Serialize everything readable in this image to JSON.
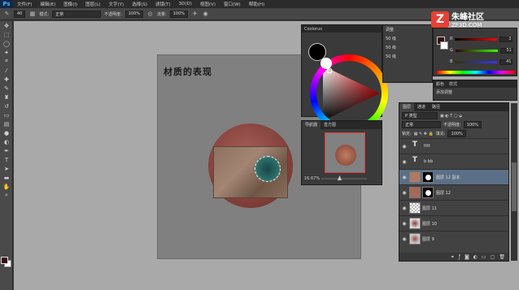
{
  "app": {
    "logo": "Ps"
  },
  "menu": [
    "文件(F)",
    "编辑(E)",
    "图像(I)",
    "图层(L)",
    "文字(Y)",
    "选择(S)",
    "滤镜(T)",
    "3D(D)",
    "视图(V)",
    "窗口(W)",
    "帮助(H)"
  ],
  "options": {
    "size": "40",
    "mode_label": "模式:",
    "mode_value": "正常",
    "opacity_label": "不透明度:",
    "opacity_value": "100%",
    "flow_label": "流量:",
    "flow_value": "100%"
  },
  "canvas": {
    "title": "材质的表现"
  },
  "color_panel": {
    "tab": "Coolorus"
  },
  "adjust_panel": {
    "rows": [
      "调整",
      "50 级",
      "50 级",
      "50 级"
    ]
  },
  "navigator": {
    "tabs": [
      "导航器",
      "直方图"
    ],
    "zoom": "16.67%"
  },
  "rgb_panel": {
    "rows": [
      {
        "label": "R",
        "value": "3"
      },
      {
        "label": "G",
        "value": "51"
      },
      {
        "label": "B",
        "value": "41"
      }
    ]
  },
  "style_panel": {
    "tabs": [
      "颜色",
      "样式"
    ],
    "label": "添加调整"
  },
  "layers_panel": {
    "tabs": [
      "图层",
      "通道",
      "路径"
    ],
    "filter": "P 类型",
    "blend": "正常",
    "opacity_label": "不透明度:",
    "opacity_value": "100%",
    "lock_label": "锁定:",
    "fill_label": "填充:",
    "fill_value": "100%",
    "layers": [
      {
        "name": "tttt",
        "type": "text"
      },
      {
        "name": "b bb",
        "type": "text"
      },
      {
        "name": "图层 12 副本",
        "type": "masked",
        "selected": true
      },
      {
        "name": "图层 12",
        "type": "masked"
      },
      {
        "name": "图层 11",
        "type": "plain"
      },
      {
        "name": "图层 10",
        "type": "image"
      },
      {
        "name": "图层 9",
        "type": "image"
      }
    ]
  },
  "watermark": {
    "logo": "Z",
    "cn": "朱峰社区",
    "url": "ZF3D.COM"
  },
  "colors": {
    "fg": "#3a0d0d",
    "bg": "#ffffff",
    "selection": "#5b6f86"
  }
}
